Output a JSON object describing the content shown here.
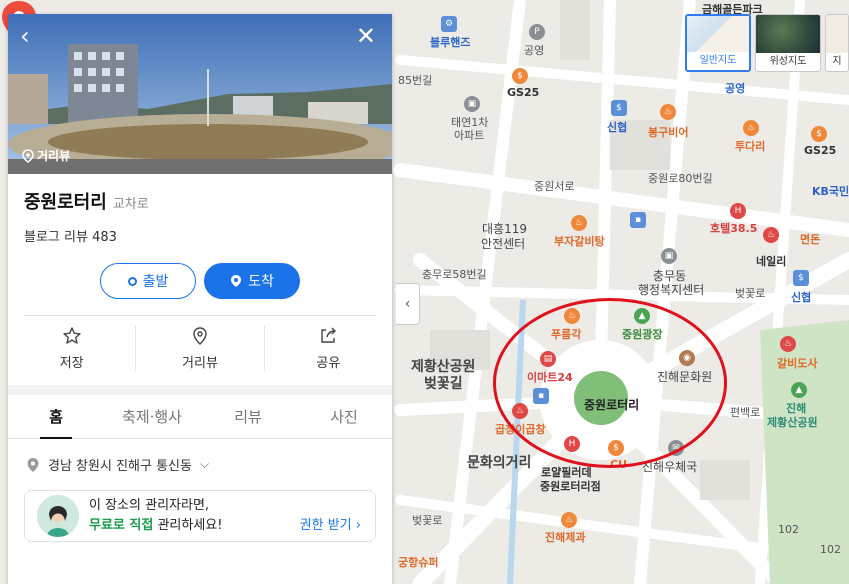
{
  "map": {
    "labels": {
      "gumgolpark": "금해골든파크",
      "bluehands": "블루핸즈",
      "office": "공영",
      "beonji": "85번길",
      "gs25a": "GS25",
      "taeyeon": "태연1차",
      "apt": "아파트",
      "sinhyeop1": "신협",
      "bonggu": "봉구비어",
      "gs25b": "GS25",
      "tudari": "투다리",
      "sinhyeop_top": "공영",
      "kb": "KB국민",
      "jungwonseoro": "중원서로",
      "jungwon80": "중원로80번길",
      "daeheung": "대흥119",
      "safety": "안전센터",
      "bujagal": "부자갈비탕",
      "hotel": "호텔38.5",
      "myeondon": "면돈",
      "chungmu": "충무동",
      "welfare": "행정복지센터",
      "nail": "네일리",
      "chungmuro58": "충무로58번길",
      "sinhyeop2": "신협",
      "beotkkot": "벚꽃로",
      "purumgak": "푸름각",
      "jungwonsquare": "중원광장",
      "jehwang": "제황산공원",
      "beotkkotgil": "벚꽃길",
      "emart": "이마트24",
      "jinhaeculture": "진해문화원",
      "galbi": "갈비도사",
      "jinhaepark": "진해",
      "jehwangpark": "제황산공원",
      "pyeonbaek": "편백로",
      "gopchang": "곱창이곱창",
      "munhwa": "문화의거리",
      "royal": "로얄필러데",
      "royal2": "중원로터리점",
      "cu": "CU",
      "jinhaeusu": "진해우체국",
      "beotkkot2": "벚꽃로",
      "jinhaebakery": "진해제과",
      "num102a": "102",
      "num102b": "102",
      "gaedang": "궁항슈퍼"
    },
    "place_name": "중원로터리",
    "map_type": {
      "normal": "일반지도",
      "satellite": "위성지도",
      "terrain": "지"
    }
  },
  "panel": {
    "roadview_tag": "거리뷰",
    "title": "중원로터리",
    "category": "교차로",
    "review": "블로그 리뷰 483",
    "start_label": "출발",
    "end_label": "도착",
    "actions": {
      "save": "저장",
      "roadview": "거리뷰",
      "share": "공유"
    },
    "tabs": [
      "홈",
      "축제·행사",
      "리뷰",
      "사진"
    ],
    "address": "경남 창원시 진해구 통신동",
    "claim": {
      "line1": "이 장소의 관리자라면,",
      "highlight": "무료로 직접",
      "line2_rest": " 관리하세요!",
      "link": "권한 받기"
    }
  },
  "colors": {
    "accent": "#1a73e8",
    "highlight_ring": "#e0101c",
    "pin": "#ee4b3d",
    "green_text": "#1a9b48"
  }
}
